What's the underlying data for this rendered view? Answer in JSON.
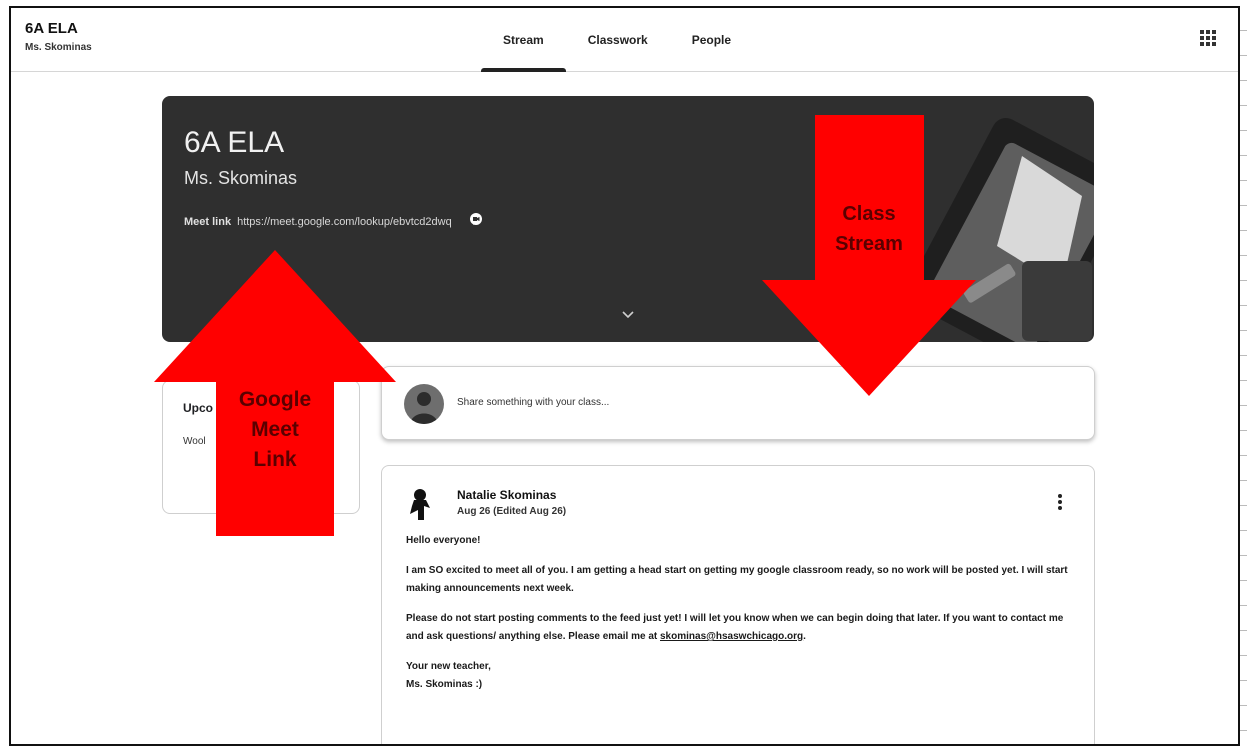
{
  "header": {
    "class_title": "6A ELA",
    "teacher": "Ms. Skominas",
    "tabs": [
      {
        "label": "Stream",
        "active": true
      },
      {
        "label": "Classwork",
        "active": false
      },
      {
        "label": "People",
        "active": false
      }
    ],
    "apps_icon": "apps-grid-icon"
  },
  "banner": {
    "title": "6A ELA",
    "subtitle": "Ms. Skominas",
    "meet_label": "Meet link",
    "meet_url": "https://meet.google.com/lookup/ebvtcd2dwq",
    "meet_icon": "video-chat-icon",
    "expand_icon": "chevron-down-icon"
  },
  "upcoming": {
    "title": "Upco",
    "text": "Wool"
  },
  "share": {
    "placeholder": "Share something with your class..."
  },
  "post": {
    "author": "Natalie Skominas",
    "date": "Aug 26 (Edited Aug 26)",
    "greeting": "Hello everyone!",
    "paragraph1": "I am SO excited to meet all of you. I am getting a head start on getting my google classroom ready, so no work will be posted yet. I will start making announcements next week.",
    "paragraph2_pre": "Please do not start posting comments to the feed just yet! I will let you know when we can begin doing that later. If you want to contact me and ask questions/ anything else. Please email me at ",
    "email": "skominas@hsaswchicago.org",
    "paragraph2_post": ".",
    "signoff1": "Your new teacher,",
    "signoff2": "Ms. Skominas :)"
  },
  "annotations": {
    "meet_arrow": [
      "Google",
      "Meet",
      "Link"
    ],
    "stream_arrow": [
      "Class",
      "Stream"
    ],
    "color": "#ff0000"
  },
  "colors": {
    "banner_bg": "#2f2f2f",
    "text": "#202124",
    "annotation": "#ff0000"
  }
}
